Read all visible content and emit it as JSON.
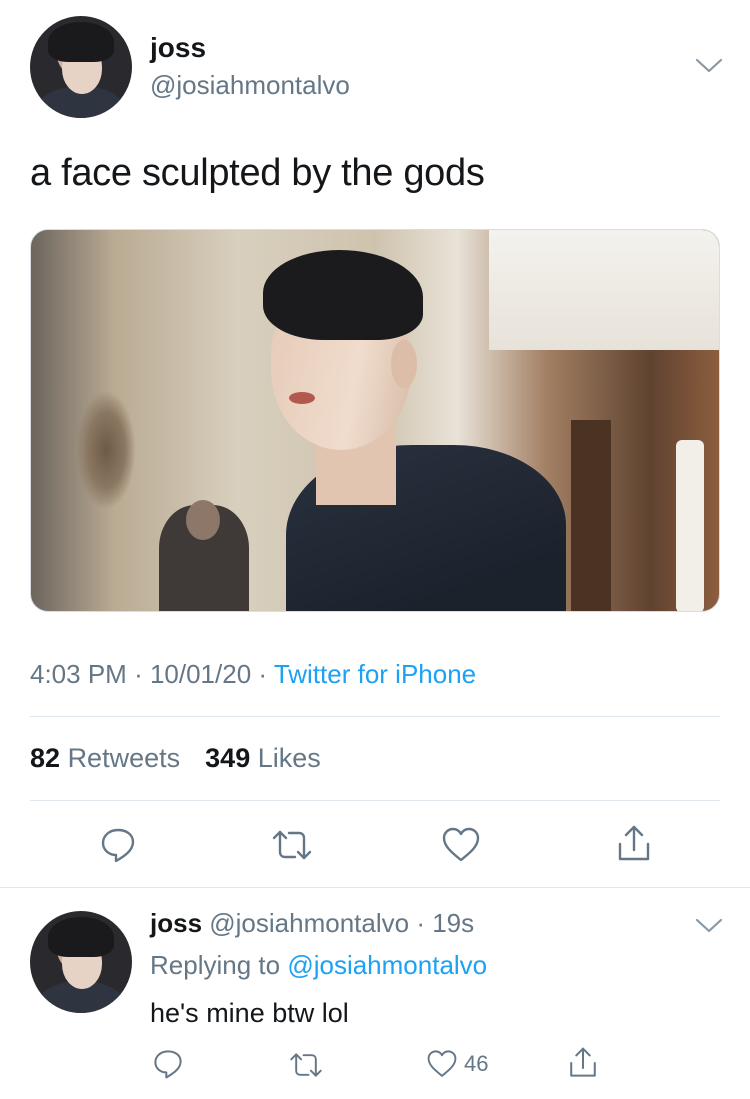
{
  "tweet": {
    "display_name": "joss",
    "handle": "@josiahmontalvo",
    "text": "a face sculpted by the gods",
    "time": "4:03 PM",
    "date": "10/01/20",
    "source": "Twitter for iPhone",
    "retweets_count": "82",
    "retweets_label": "Retweets",
    "likes_count": "349",
    "likes_label": "Likes"
  },
  "reply": {
    "display_name": "joss",
    "handle": "@josiahmontalvo",
    "age": "19s",
    "replying_to_label": "Replying to",
    "replying_to_handle": "@josiahmontalvo",
    "text": "he's mine btw lol",
    "like_count": "46"
  },
  "icons": {
    "chevron": "chevron-down-icon",
    "reply": "reply-icon",
    "retweet": "retweet-icon",
    "like": "heart-icon",
    "share": "share-icon"
  },
  "colors": {
    "link": "#1da1f2",
    "secondary_text": "#657786",
    "primary_text": "#14171a",
    "divider": "#e1e8ed"
  }
}
